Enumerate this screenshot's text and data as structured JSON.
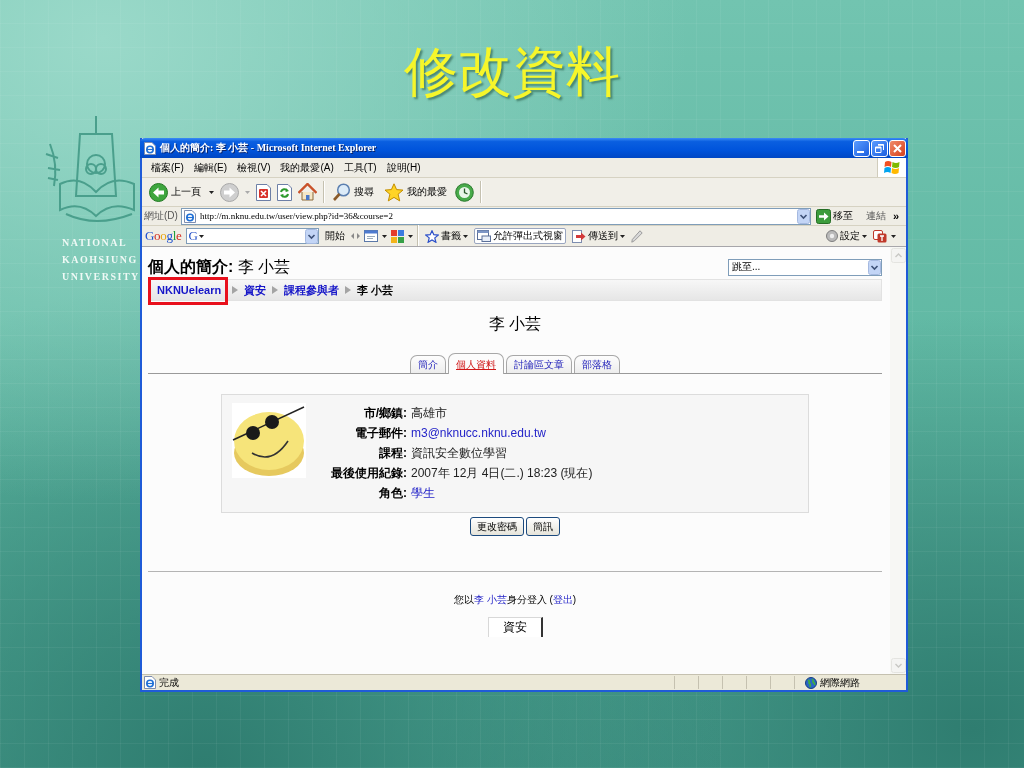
{
  "slide": {
    "title": "修改資料",
    "logo_lines": [
      "NATIONAL",
      "KAOHSIUNG",
      "UNIVERSITY"
    ]
  },
  "window": {
    "title": "個人的簡介: 李 小芸 - Microsoft Internet Explorer"
  },
  "menu": [
    "檔案(F)",
    "編輯(E)",
    "檢視(V)",
    "我的最愛(A)",
    "工具(T)",
    "說明(H)"
  ],
  "toolbar": {
    "back": "上一頁",
    "search": "搜尋",
    "favorites": "我的最愛"
  },
  "address_bar": {
    "label": "網址(D)",
    "url": "http://m.nknu.edu.tw/user/view.php?id=36&course=2",
    "go": "移至",
    "links": "連結",
    "more": "»"
  },
  "google_bar": {
    "logo": "Google",
    "search_menu": "G",
    "start": "開始",
    "bookmarks": "書籤",
    "popups": "允許彈出式視窗",
    "send_to": "傳送到",
    "settings": "設定"
  },
  "page": {
    "heading": "**個人的簡介:** 李 小芸",
    "jump_menu": {
      "value": "跳至..."
    },
    "breadcrumb": [
      {
        "label": "NKNUelearn",
        "link": true,
        "highlighted": true
      },
      {
        "label": "資安",
        "link": true,
        "highlighted": false
      },
      {
        "label": "課程參與者",
        "link": true,
        "highlighted": false
      },
      {
        "label": "李 小芸",
        "link": false,
        "highlighted": false
      }
    ],
    "user_name": "李 小芸",
    "tabs": [
      {
        "label": "簡介",
        "selected": false
      },
      {
        "label": "個人資料",
        "selected": true
      },
      {
        "label": "討論區文章",
        "selected": false
      },
      {
        "label": "部落格",
        "selected": false
      }
    ],
    "profile": [
      {
        "label": "市/鄉鎮:",
        "value": "高雄市",
        "link": false
      },
      {
        "label": "電子郵件:",
        "value": "m3@nknucc.nknu.edu.tw",
        "link": true
      },
      {
        "label": "課程:",
        "value": "資訊安全數位學習",
        "link": false
      },
      {
        "label": "最後使用紀錄:",
        "value": "2007年 12月 4日(二.) 18:23 (現在)",
        "link": false
      },
      {
        "label": "角色:",
        "value": "學生",
        "link": true
      }
    ],
    "buttons": [
      "更改密碼",
      "簡訊"
    ],
    "login": {
      "prefix": "您以",
      "user": "李 小芸",
      "middle": "身分登入 (",
      "logout": "登出",
      "suffix": ")"
    },
    "course_link": "資安"
  },
  "status_bar": {
    "text": "完成",
    "zone": "網際網路"
  }
}
